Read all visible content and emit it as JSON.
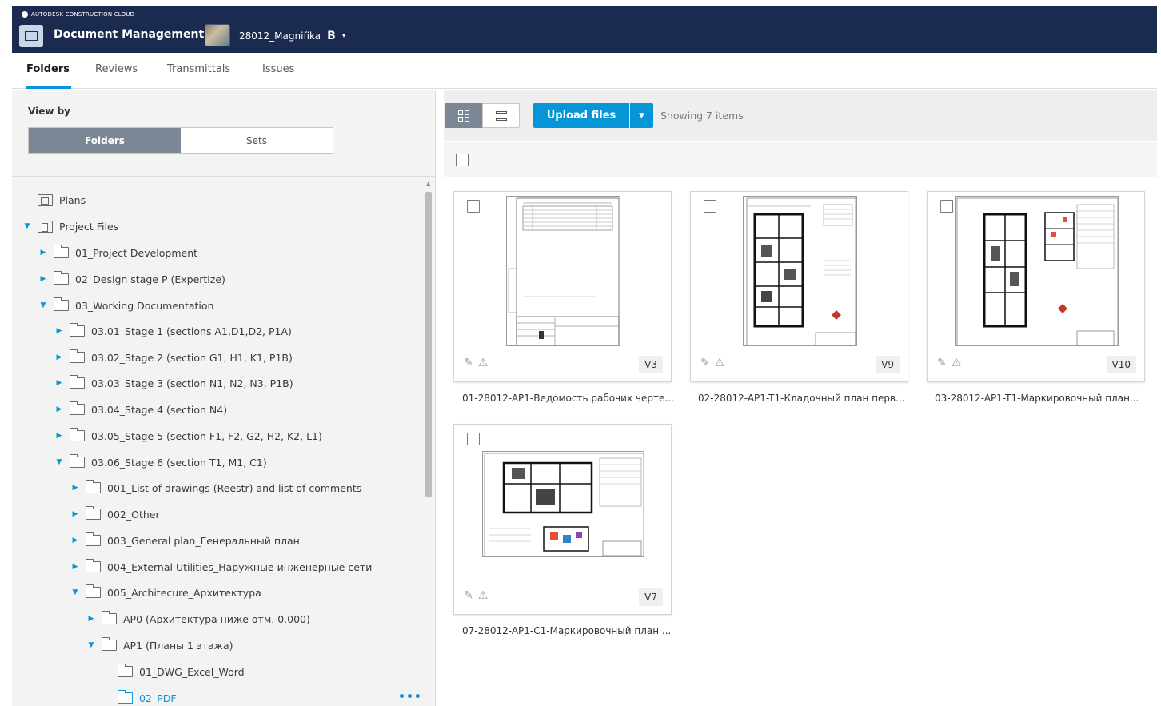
{
  "header": {
    "brand": "AUTODESK CONSTRUCTION CLOUD",
    "app_title": "Document Management",
    "project_name": "28012_Magnifika",
    "project_badge": "B"
  },
  "tabs": [
    {
      "label": "Folders",
      "active": true
    },
    {
      "label": "Reviews",
      "active": false
    },
    {
      "label": "Transmittals",
      "active": false
    },
    {
      "label": "Issues",
      "active": false
    }
  ],
  "sidebar": {
    "view_by_label": "View by",
    "toggle": {
      "folders": "Folders",
      "sets": "Sets",
      "selected": "Folders"
    },
    "tree": [
      {
        "label": "Plans"
      },
      {
        "label": "Project Files",
        "expanded": true
      },
      {
        "label": "01_Project Development",
        "expanded": false
      },
      {
        "label": "02_Design stage P (Expertize)",
        "expanded": false
      },
      {
        "label": "03_Working Documentation",
        "expanded": true
      },
      {
        "label": "03.01_Stage 1 (sections A1,D1,D2, P1A)",
        "expanded": false
      },
      {
        "label": "03.02_Stage 2 (section G1, H1, K1, P1B)",
        "expanded": false
      },
      {
        "label": "03.03_Stage 3 (section N1, N2, N3, P1B)",
        "expanded": false
      },
      {
        "label": "03.04_Stage 4 (section N4)",
        "expanded": false
      },
      {
        "label": "03.05_Stage 5 (section F1, F2, G2, H2, K2, L1)",
        "expanded": false
      },
      {
        "label": "03.06_Stage 6 (section T1, M1, C1)",
        "expanded": true
      },
      {
        "label": "001_List of drawings (Reestr) and list of comments",
        "expanded": false
      },
      {
        "label": "002_Other",
        "expanded": false
      },
      {
        "label": "003_General plan_Генеральный план",
        "expanded": false
      },
      {
        "label": "004_External Utilities_Наружные инженерные сети",
        "expanded": false
      },
      {
        "label": "005_Architecure_Архитектура",
        "expanded": true
      },
      {
        "label": "AP0 (Архитектура ниже отм. 0.000)",
        "expanded": false
      },
      {
        "label": "AP1 (Планы 1 этажа)",
        "expanded": true
      },
      {
        "label": "01_DWG_Excel_Word"
      },
      {
        "label": "02_PDF",
        "selected": true
      }
    ],
    "more_label": "•••"
  },
  "toolbar": {
    "upload_label": "Upload files",
    "showing_text": "Showing 7 items"
  },
  "files": [
    {
      "name": "01-28012-AP1-Ведомость рабочих черте...",
      "version": "V3"
    },
    {
      "name": "02-28012-AP1-T1-Кладочный план перв...",
      "version": "V9"
    },
    {
      "name": "03-28012-AP1-T1-Маркировочный план...",
      "version": "V10"
    },
    {
      "name": "07-28012-AP1-C1-Маркировочный план ...",
      "version": "V7"
    }
  ],
  "colors": {
    "header_bg": "#1b2b4f",
    "accent": "#0696d7",
    "toggle_selected": "#7b8795"
  }
}
